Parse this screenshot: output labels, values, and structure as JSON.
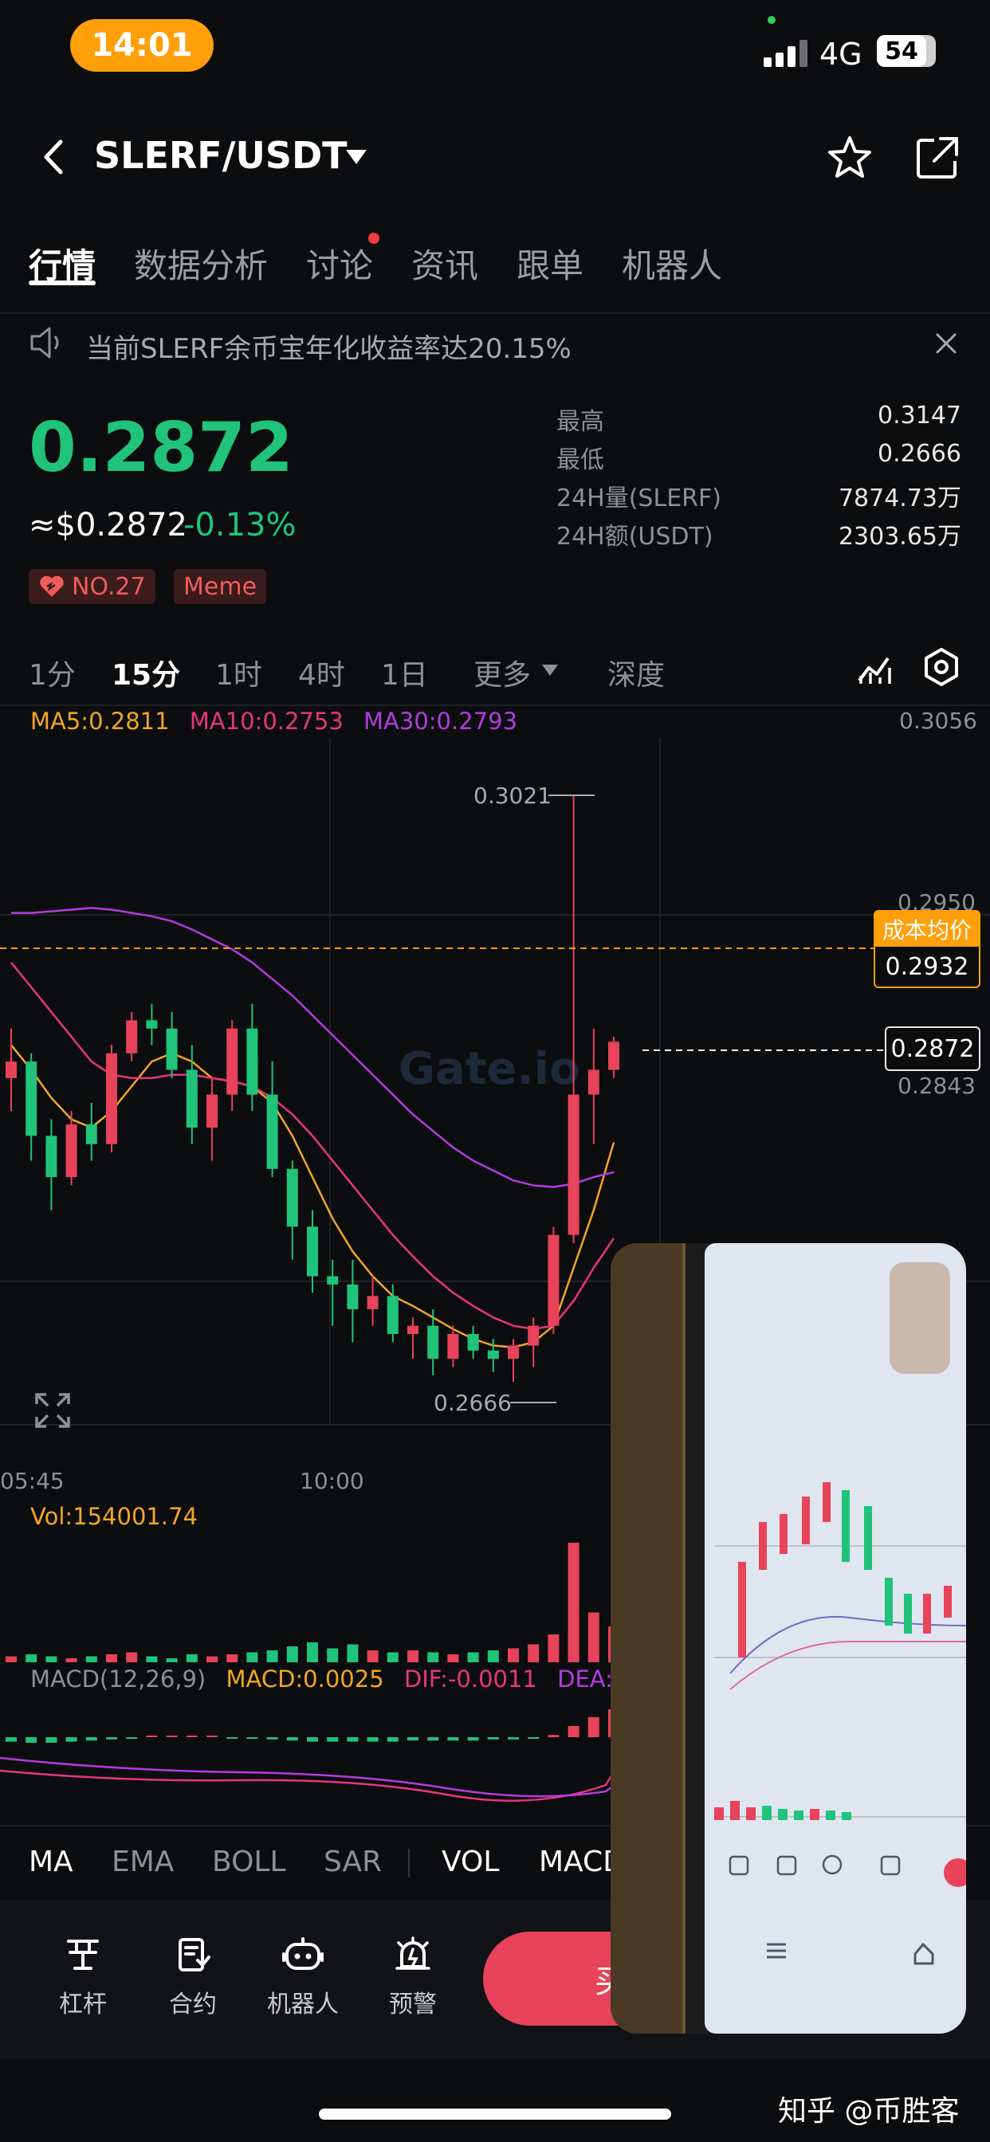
{
  "status_bar": {
    "time": "14:01",
    "network": "4G",
    "battery": "54"
  },
  "header": {
    "pair": "SLERF/USDT"
  },
  "tabs": [
    {
      "label": "行情",
      "active": true
    },
    {
      "label": "数据分析"
    },
    {
      "label": "讨论",
      "dot": true
    },
    {
      "label": "资讯"
    },
    {
      "label": "跟单"
    },
    {
      "label": "机器人"
    }
  ],
  "notice": {
    "text": "当前SLERF余币宝年化收益率达20.15%"
  },
  "price": {
    "last": "0.2872",
    "fiat": "≈$0.2872",
    "change": "-0.13%",
    "rank_badge": "NO.27",
    "tag_badge": "Meme"
  },
  "stats": [
    {
      "label": "最高",
      "value": "0.3147"
    },
    {
      "label": "最低",
      "value": "0.2666"
    },
    {
      "label": "24H量(SLERF)",
      "value": "7874.73万"
    },
    {
      "label": "24H额(USDT)",
      "value": "2303.65万"
    }
  ],
  "timeframes": [
    {
      "label": "1分"
    },
    {
      "label": "15分",
      "active": true
    },
    {
      "label": "1时"
    },
    {
      "label": "4时"
    },
    {
      "label": "1日"
    },
    {
      "label": "更多"
    },
    {
      "label": "深度"
    }
  ],
  "chart": {
    "ma_legend": [
      {
        "text": "MA5:0.2811",
        "color": "#f5a623"
      },
      {
        "text": "MA10:0.2753",
        "color": "#e8357f"
      },
      {
        "text": "MA30:0.2793",
        "color": "#b43be0"
      }
    ],
    "axis_top": "0.3056",
    "axis_ticks": [
      "0.2950",
      "0.2843"
    ],
    "high_label": "0.3021",
    "low_label": "0.2666",
    "current_price_tag": "0.2872",
    "cost_label": "成本均价",
    "cost_value": "0.2932",
    "time_labels": [
      "05:45",
      "10:00"
    ],
    "watermark": "Gate.io",
    "volume_label": "Vol:154001.74",
    "macd_legend": [
      {
        "text": "MACD(12,26,9)",
        "color": "#8d9096"
      },
      {
        "text": "MACD:0.0025",
        "color": "#f5a623"
      },
      {
        "text": "DIF:-0.0011",
        "color": "#e8357f"
      },
      {
        "text": "DEA:",
        "color": "#b43be0"
      }
    ]
  },
  "chart_data": {
    "type": "candlestick",
    "title": "SLERF/USDT 15分",
    "ylim": [
      0.264,
      0.3056
    ],
    "x_ticks": [
      "05:45",
      "10:00"
    ],
    "candles": [
      {
        "o": 0.285,
        "h": 0.288,
        "l": 0.283,
        "c": 0.286
      },
      {
        "o": 0.286,
        "h": 0.2865,
        "l": 0.28,
        "c": 0.2815
      },
      {
        "o": 0.2815,
        "h": 0.2825,
        "l": 0.277,
        "c": 0.279
      },
      {
        "o": 0.279,
        "h": 0.283,
        "l": 0.2785,
        "c": 0.2822
      },
      {
        "o": 0.2822,
        "h": 0.2835,
        "l": 0.28,
        "c": 0.281
      },
      {
        "o": 0.281,
        "h": 0.287,
        "l": 0.2805,
        "c": 0.2865
      },
      {
        "o": 0.2865,
        "h": 0.289,
        "l": 0.286,
        "c": 0.2885
      },
      {
        "o": 0.2885,
        "h": 0.2895,
        "l": 0.287,
        "c": 0.288
      },
      {
        "o": 0.288,
        "h": 0.289,
        "l": 0.285,
        "c": 0.2855
      },
      {
        "o": 0.2855,
        "h": 0.287,
        "l": 0.281,
        "c": 0.282
      },
      {
        "o": 0.282,
        "h": 0.285,
        "l": 0.28,
        "c": 0.284
      },
      {
        "o": 0.284,
        "h": 0.2885,
        "l": 0.283,
        "c": 0.288
      },
      {
        "o": 0.288,
        "h": 0.2895,
        "l": 0.283,
        "c": 0.284
      },
      {
        "o": 0.284,
        "h": 0.286,
        "l": 0.279,
        "c": 0.2795
      },
      {
        "o": 0.2795,
        "h": 0.28,
        "l": 0.274,
        "c": 0.276
      },
      {
        "o": 0.276,
        "h": 0.277,
        "l": 0.272,
        "c": 0.273
      },
      {
        "o": 0.273,
        "h": 0.274,
        "l": 0.27,
        "c": 0.2725
      },
      {
        "o": 0.2725,
        "h": 0.274,
        "l": 0.269,
        "c": 0.271
      },
      {
        "o": 0.271,
        "h": 0.273,
        "l": 0.27,
        "c": 0.2718
      },
      {
        "o": 0.2718,
        "h": 0.2725,
        "l": 0.269,
        "c": 0.2695
      },
      {
        "o": 0.2695,
        "h": 0.2705,
        "l": 0.268,
        "c": 0.27
      },
      {
        "o": 0.27,
        "h": 0.271,
        "l": 0.267,
        "c": 0.268
      },
      {
        "o": 0.268,
        "h": 0.27,
        "l": 0.2675,
        "c": 0.2695
      },
      {
        "o": 0.2695,
        "h": 0.27,
        "l": 0.268,
        "c": 0.2685
      },
      {
        "o": 0.2685,
        "h": 0.2692,
        "l": 0.2672,
        "c": 0.268
      },
      {
        "o": 0.268,
        "h": 0.2692,
        "l": 0.2666,
        "c": 0.2688
      },
      {
        "o": 0.2688,
        "h": 0.2705,
        "l": 0.2675,
        "c": 0.27
      },
      {
        "o": 0.27,
        "h": 0.276,
        "l": 0.2695,
        "c": 0.2755
      },
      {
        "o": 0.2755,
        "h": 0.3021,
        "l": 0.275,
        "c": 0.284
      },
      {
        "o": 0.284,
        "h": 0.288,
        "l": 0.281,
        "c": 0.2855
      },
      {
        "o": 0.2855,
        "h": 0.2875,
        "l": 0.285,
        "c": 0.2872
      }
    ],
    "series": [
      {
        "name": "MA5",
        "values": [
          0.287,
          0.2855,
          0.2838,
          0.2825,
          0.282,
          0.283,
          0.2845,
          0.286,
          0.2865,
          0.286,
          0.285,
          0.2848,
          0.2845,
          0.2835,
          0.2815,
          0.279,
          0.2765,
          0.2745,
          0.273,
          0.2718,
          0.2712,
          0.2705,
          0.2698,
          0.2692,
          0.2688,
          0.2687,
          0.269,
          0.27,
          0.2735,
          0.277,
          0.2811
        ]
      },
      {
        "name": "MA10",
        "values": [
          0.292,
          0.2905,
          0.289,
          0.2875,
          0.286,
          0.2852,
          0.285,
          0.285,
          0.2852,
          0.2852,
          0.285,
          0.2848,
          0.2845,
          0.2838,
          0.2828,
          0.2815,
          0.28,
          0.2785,
          0.277,
          0.2755,
          0.2742,
          0.273,
          0.272,
          0.2712,
          0.2705,
          0.27,
          0.2698,
          0.27,
          0.2715,
          0.2735,
          0.2753
        ]
      },
      {
        "name": "MA30",
        "values": [
          0.295,
          0.295,
          0.2951,
          0.2952,
          0.2953,
          0.2952,
          0.295,
          0.2948,
          0.2945,
          0.294,
          0.2934,
          0.2928,
          0.292,
          0.291,
          0.29,
          0.2888,
          0.2876,
          0.2864,
          0.2852,
          0.284,
          0.2828,
          0.2818,
          0.2808,
          0.28,
          0.2794,
          0.2788,
          0.2785,
          0.2784,
          0.2786,
          0.279,
          0.2793
        ]
      }
    ],
    "volumes": [
      3,
      4,
      3,
      2,
      3,
      4,
      5,
      3,
      2,
      4,
      3,
      4,
      5,
      6,
      8,
      10,
      7,
      9,
      6,
      5,
      6,
      5,
      4,
      5,
      6,
      7,
      9,
      14,
      60,
      25,
      18
    ],
    "macd_hist": [
      -0.0004,
      -0.0005,
      -0.0005,
      -0.0004,
      -0.0003,
      -0.0002,
      -0.0001,
      0.0001,
      0.0001,
      0.0001,
      0.0,
      -0.0001,
      -0.0001,
      -0.0002,
      -0.0003,
      -0.0004,
      -0.0004,
      -0.0004,
      -0.0004,
      -0.0004,
      -0.0003,
      -0.0003,
      -0.0003,
      -0.0003,
      -0.0002,
      -0.0002,
      -0.0001,
      0.0002,
      0.001,
      0.0018,
      0.0025
    ]
  },
  "indicator_tabs": [
    {
      "label": "MA",
      "active": true
    },
    {
      "label": "EMA"
    },
    {
      "label": "BOLL"
    },
    {
      "label": "SAR"
    },
    {
      "label": "VOL",
      "active": true
    },
    {
      "label": "MACD"
    }
  ],
  "bottom_nav": [
    {
      "label": "杠杆",
      "icon": "leverage-icon"
    },
    {
      "label": "合约",
      "icon": "contract-icon"
    },
    {
      "label": "机器人",
      "icon": "robot-icon"
    },
    {
      "label": "预警",
      "icon": "alarm-icon"
    }
  ],
  "buy_button": "买入",
  "footer_watermark": "知乎 @币胜客",
  "colors": {
    "up": "#e8435a",
    "down": "#1fc47a",
    "accent": "#ff9f0a"
  }
}
